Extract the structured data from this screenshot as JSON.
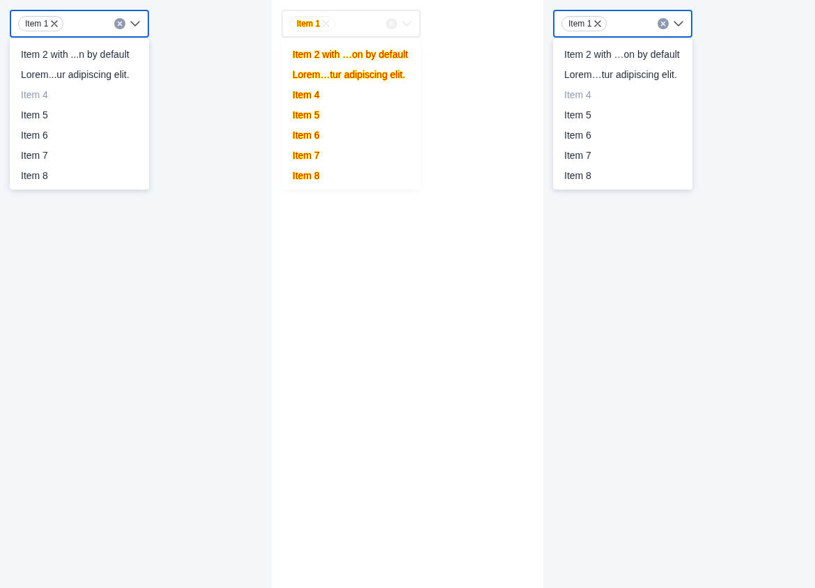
{
  "panels": [
    {
      "kind": "normal",
      "select": {
        "focused": true,
        "tags": [
          {
            "label": "Item 1"
          }
        ]
      },
      "options": [
        {
          "label": "Item 2 with ...n by default",
          "disabled": false
        },
        {
          "label": "Lorem...ur adipiscing elit.",
          "disabled": false
        },
        {
          "label": "Item 4",
          "disabled": true
        },
        {
          "label": "Item 5",
          "disabled": false
        },
        {
          "label": "Item 6",
          "disabled": false
        },
        {
          "label": "Item 7",
          "disabled": false
        },
        {
          "label": "Item 8",
          "disabled": false
        }
      ]
    },
    {
      "kind": "diff",
      "select": {
        "tags": [
          {
            "label": "Item 1"
          }
        ]
      },
      "options": [
        {
          "label": "Item 2 with …on by default"
        },
        {
          "label": "Lorem…tur adipiscing elit."
        },
        {
          "label": "Item 4"
        },
        {
          "label": "Item 5"
        },
        {
          "label": "Item 6"
        },
        {
          "label": "Item 7"
        },
        {
          "label": "Item 8"
        }
      ]
    },
    {
      "kind": "normal",
      "select": {
        "focused": true,
        "tags": [
          {
            "label": "Item 1"
          }
        ]
      },
      "options": [
        {
          "label": "Item 2 with …on by default",
          "disabled": false
        },
        {
          "label": "Lorem…tur adipiscing elit.",
          "disabled": false
        },
        {
          "label": "Item 4",
          "disabled": true
        },
        {
          "label": "Item 5",
          "disabled": false
        },
        {
          "label": "Item 6",
          "disabled": false
        },
        {
          "label": "Item 7",
          "disabled": false
        },
        {
          "label": "Item 8",
          "disabled": false
        }
      ]
    }
  ]
}
